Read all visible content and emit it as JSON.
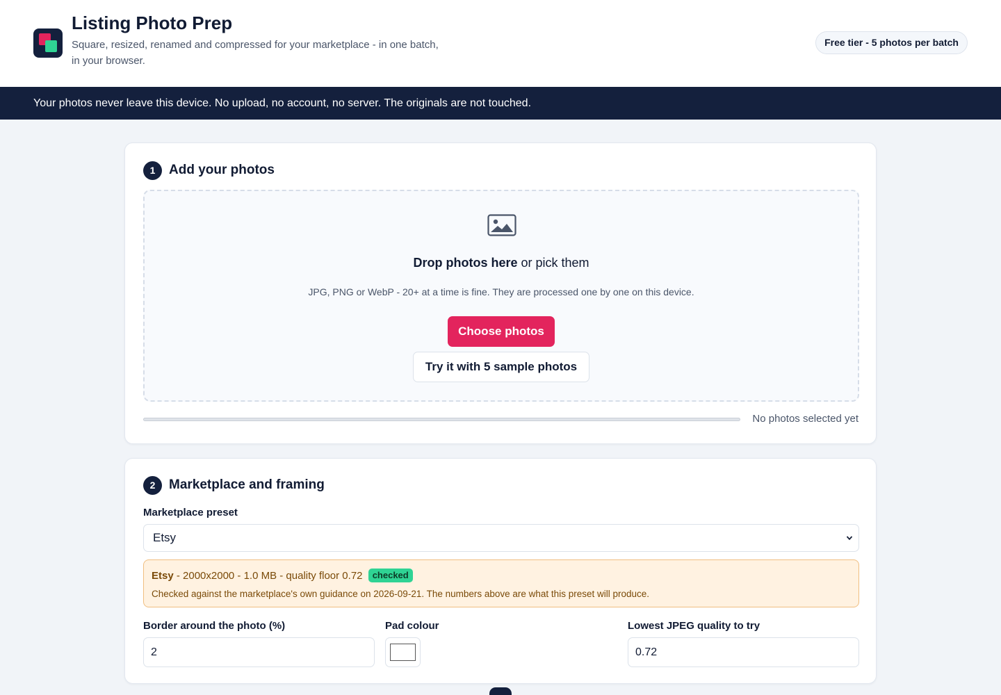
{
  "header": {
    "title": "Listing Photo Prep",
    "subtitle": "Square, resized, renamed and compressed for your marketplace - in one batch, in your browser.",
    "tier_badge": "Free tier - 5 photos per batch"
  },
  "banner": {
    "text": "Your photos never leave this device. No upload, no account, no server. The originals are not touched."
  },
  "step1": {
    "number": "1",
    "title": "Add your photos",
    "drop_strong": "Drop photos here",
    "drop_rest": " or pick them",
    "hint": "JPG, PNG or WebP - 20+ at a time is fine. They are processed one by one on this device.",
    "choose_label": "Choose photos",
    "sample_label": "Try it with 5 sample photos",
    "progress": 0,
    "status": "No photos selected yet"
  },
  "step2": {
    "number": "2",
    "title": "Marketplace and framing",
    "preset_label": "Marketplace preset",
    "preset_value": "Etsy",
    "preset_name": "Etsy",
    "preset_specs": " - 2000x2000 - 1.0 MB - quality floor 0.72",
    "checked_badge": "checked",
    "preset_detail": "Checked against the marketplace's own guidance on 2026-09-21. The numbers above are what this preset will produce.",
    "border_label": "Border around the photo (%)",
    "border_value": "2",
    "pad_label": "Pad colour",
    "pad_colour": "#ffffff",
    "quality_label": "Lowest JPEG quality to try",
    "quality_value": "0.72"
  },
  "colors": {
    "accent": "#e3245d",
    "navy": "#14203d",
    "success": "#2fd394",
    "warning_bg": "#fff2e1"
  }
}
